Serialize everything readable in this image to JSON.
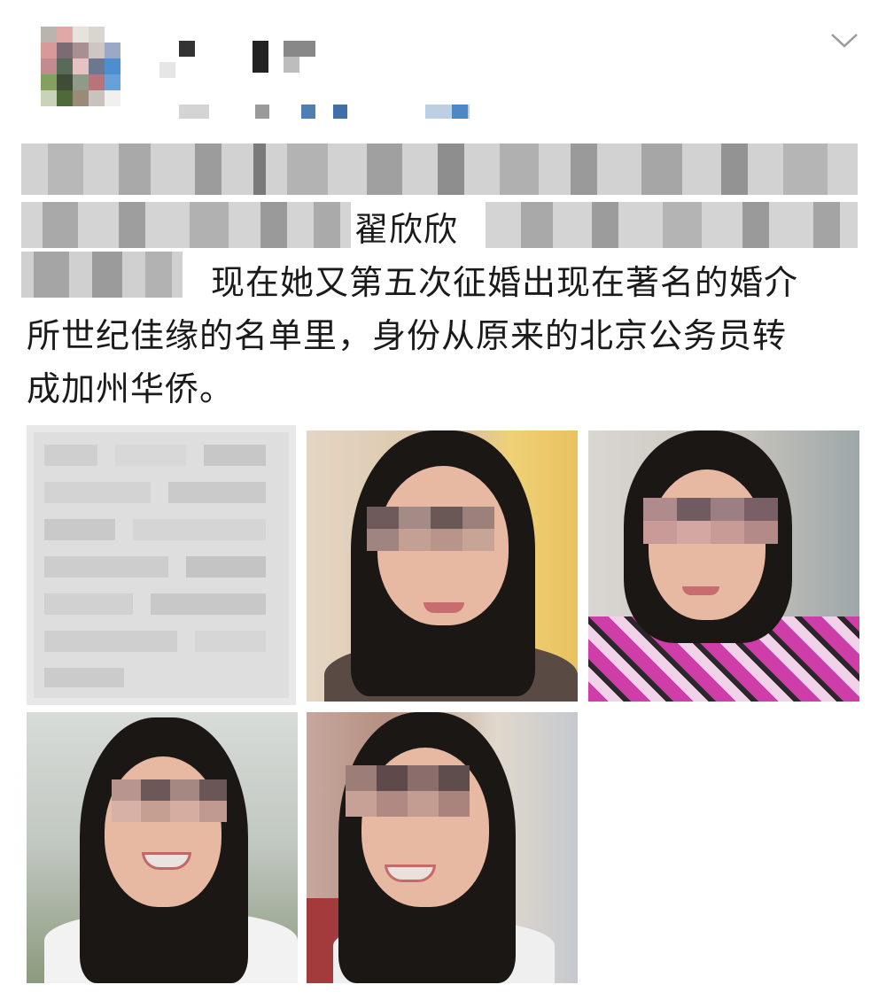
{
  "header": {
    "avatar_icon": "user-avatar-icon",
    "menu_icon": "chevron-down-icon"
  },
  "post": {
    "line2_visible": "翟欣欣",
    "line3_visible": "现在她又第五次征婚出现在著名的婚介",
    "line4": "所世纪佳缘的名单里，身份从原来的北京公务员转",
    "line5": "成加州华侨。"
  },
  "images": [
    {
      "name": "blurred-screenshot-image"
    },
    {
      "name": "selfie-photo-1"
    },
    {
      "name": "selfie-photo-2"
    },
    {
      "name": "selfie-photo-3"
    },
    {
      "name": "selfie-photo-4"
    }
  ]
}
